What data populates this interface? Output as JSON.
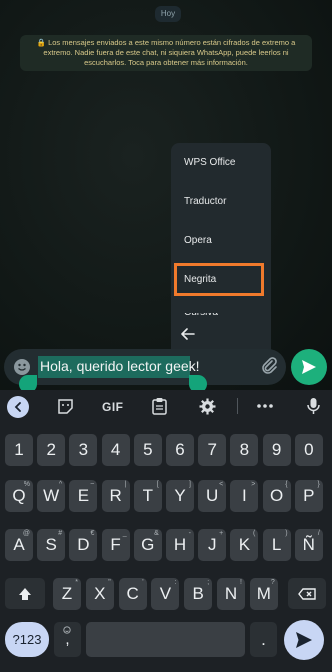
{
  "chat": {
    "date": "Hoy",
    "encryption_notice": "🔒 Los mensajes enviados a este mismo número están cifrados de extremo a extremo. Nadie fuera de este chat, ni siquiera WhatsApp, puede leerlos ni escucharlos. Toca para obtener más información."
  },
  "context_menu": {
    "items": [
      "WPS Office",
      "Traductor",
      "Opera",
      "Negrita",
      "Cursiva"
    ],
    "highlighted": "Negrita",
    "highlight_color": "#f07a2c"
  },
  "composer": {
    "text": "Hola, querido lector geek!",
    "send_color": "#1db07c",
    "selection_color": "#1d6b5d"
  },
  "keyboard": {
    "toolbar": [
      "chevron-left-icon",
      "sticker-icon",
      "GIF",
      "clipboard-icon",
      "gear-icon",
      "more-icon",
      "mic-icon"
    ],
    "gif_label": "GIF",
    "row_numbers": [
      "1",
      "2",
      "3",
      "4",
      "5",
      "6",
      "7",
      "8",
      "9",
      "0"
    ],
    "row_q": [
      "Q",
      "W",
      "E",
      "R",
      "T",
      "Y",
      "U",
      "I",
      "O",
      "P"
    ],
    "row_q_alt": [
      "%",
      "^",
      "~",
      "|",
      "[",
      "]",
      "<",
      ">",
      "{",
      "}"
    ],
    "row_a": [
      "A",
      "S",
      "D",
      "F",
      "G",
      "H",
      "J",
      "K",
      "L",
      "Ñ"
    ],
    "row_a_alt": [
      "@",
      "#",
      "€",
      "_",
      "&",
      "-",
      "+",
      "(",
      ")",
      "/"
    ],
    "row_z": [
      "Z",
      "X",
      "C",
      "V",
      "B",
      "N",
      "M"
    ],
    "row_z_alt": [
      "*",
      "\"",
      "'",
      ":",
      ";",
      "!",
      "?"
    ],
    "symbols_label": "?123",
    "comma": ",",
    "period": ".",
    "key_color": "#3a3f44",
    "accent": "#c8d6f4"
  }
}
